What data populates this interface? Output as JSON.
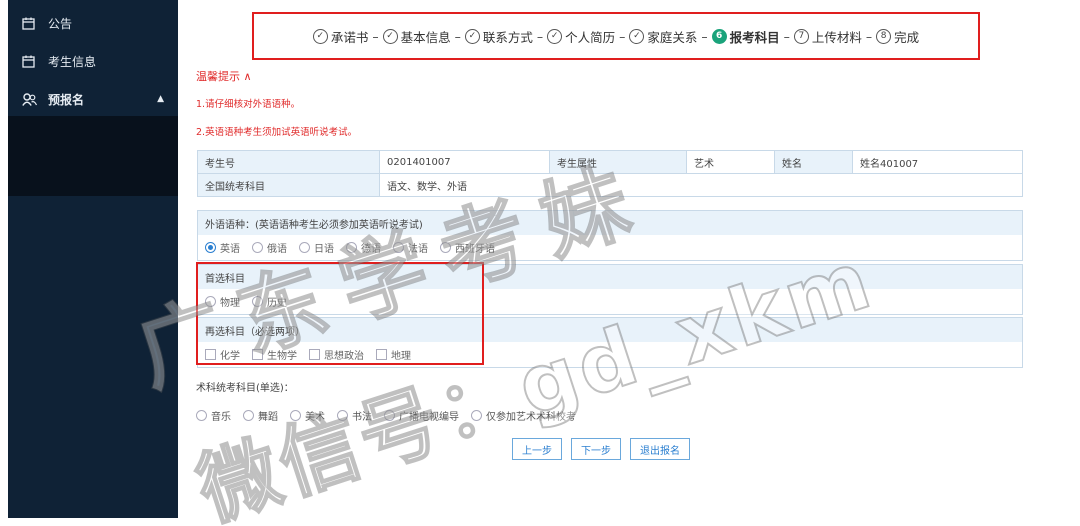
{
  "sidebar": {
    "items": [
      {
        "label": "公告"
      },
      {
        "label": "考生信息"
      },
      {
        "label": "预报名"
      }
    ]
  },
  "steps": [
    {
      "icon": "✓",
      "label": "承诺书"
    },
    {
      "icon": "✓",
      "label": "基本信息"
    },
    {
      "icon": "✓",
      "label": "联系方式"
    },
    {
      "icon": "✓",
      "label": "个人简历"
    },
    {
      "icon": "✓",
      "label": "家庭关系"
    },
    {
      "icon": "6",
      "label": "报考科目"
    },
    {
      "icon": "7",
      "label": "上传材料"
    },
    {
      "icon": "8",
      "label": "完成"
    }
  ],
  "tips": {
    "title": "温馨提示 ∧",
    "lines": [
      "1.请仔细核对外语语种。",
      "2.英语语种考生须加试英语听说考试。"
    ]
  },
  "info": {
    "exam_no_label": "考生号",
    "exam_no": "0201401007",
    "attr_label": "考生属性",
    "attr": "艺术",
    "name_label": "姓名",
    "name": "姓名401007",
    "subjects_label": "全国统考科目",
    "subjects": "语文、数学、外语"
  },
  "foreign": {
    "title": "外语语种：(英语语种考生必须参加英语听说考试)",
    "options": [
      "英语",
      "俄语",
      "日语",
      "德语",
      "法语",
      "西班牙语"
    ]
  },
  "first": {
    "title": "首选科目",
    "options": [
      "物理",
      "历史"
    ]
  },
  "second": {
    "title": "再选科目（必选两项）",
    "options": [
      "化学",
      "生物学",
      "思想政治",
      "地理"
    ]
  },
  "art": {
    "title": "术科统考科目(单选)：",
    "options": [
      "音乐",
      "舞蹈",
      "美术",
      "书法",
      "广播电视编导",
      "仅参加艺术术科校考"
    ]
  },
  "buttons": {
    "prev": "上一步",
    "next": "下一步",
    "exit": "退出报名"
  },
  "watermark": {
    "line1": "广东学考妹",
    "line2": "微信号：gd_xkm"
  },
  "colors": {
    "accent": "#1aa37b",
    "highlight": "#e01e1e",
    "tip": "#e02b2b",
    "sidebar": "#0f2236"
  }
}
